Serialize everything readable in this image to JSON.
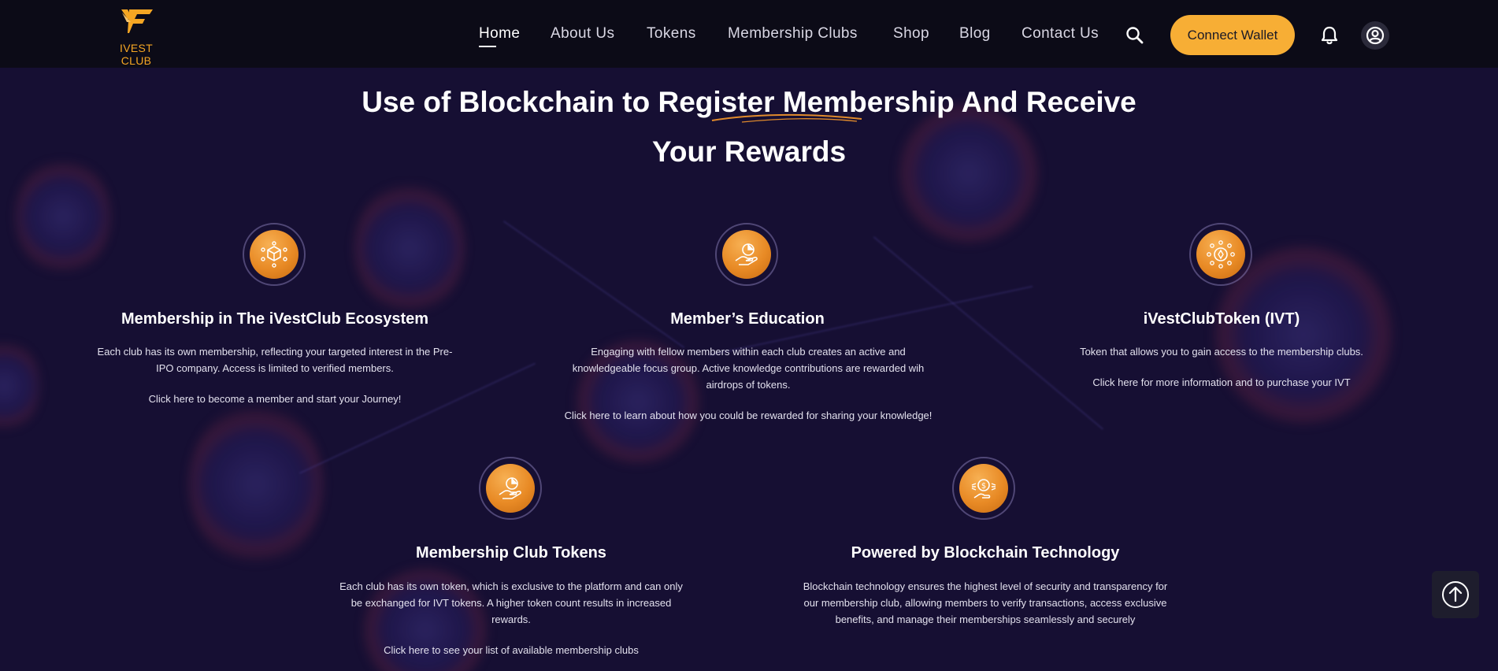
{
  "nav": {
    "logo_text": "IVEST CLUB",
    "items": [
      {
        "label": "Home",
        "active": true
      },
      {
        "label": "About Us"
      },
      {
        "label": "Tokens"
      },
      {
        "label": "Membership Clubs"
      },
      {
        "label": "Shop"
      },
      {
        "label": "Blog"
      },
      {
        "label": "Contact Us"
      }
    ],
    "search_icon": "search-icon",
    "connect_label": "Connect Wallet",
    "bell_icon": "bell-icon",
    "user_icon": "user-circle-icon"
  },
  "hero": {
    "line1": "Use of Blockchain to Register Membership And Receive",
    "line2": "Your Rewards"
  },
  "cards": [
    {
      "icon": "cube-network-icon",
      "title": "Membership in The iVestClub Ecosystem",
      "text": "Each club has its own membership, reflecting your targeted interest in the Pre-IPO company. Access is limited to verified members.",
      "link": "Click here to become a member and start your Journey!"
    },
    {
      "icon": "hand-chart-icon",
      "title": "Member’s Education",
      "text": "Engaging with fellow members within each club creates an active and knowledgeable focus group. Active knowledge contributions are rewarded wih airdrops of tokens.",
      "link": "Click here to learn about how you could be rewarded for sharing your knowledge!"
    },
    {
      "icon": "token-network-icon",
      "title": "iVestClubToken (IVT)",
      "text": "Token that allows you to gain access to the membership clubs.",
      "link": "Click here for more information and to purchase your IVT"
    },
    {
      "icon": "hand-chart-icon",
      "title": "Membership Club Tokens",
      "text": "Each club has its own token, which is exclusive to the platform and can only be exchanged for IVT tokens. A higher token count results in increased rewards.",
      "link": "Click here to see your list of available membership clubs"
    },
    {
      "icon": "coin-hand-icon",
      "title": "Powered by Blockchain Technology",
      "text": "Blockchain technology ensures the highest level of security and transparency for our membership club, allowing members to verify transactions, access exclusive benefits, and manage their memberships seamlessly and securely",
      "link": ""
    }
  ],
  "scroll_top_icon": "arrow-up-circle-icon",
  "colors": {
    "accent": "#f7ae35",
    "background": "#160f33",
    "nav": "#0c0b17",
    "logo": "#f5a623"
  }
}
